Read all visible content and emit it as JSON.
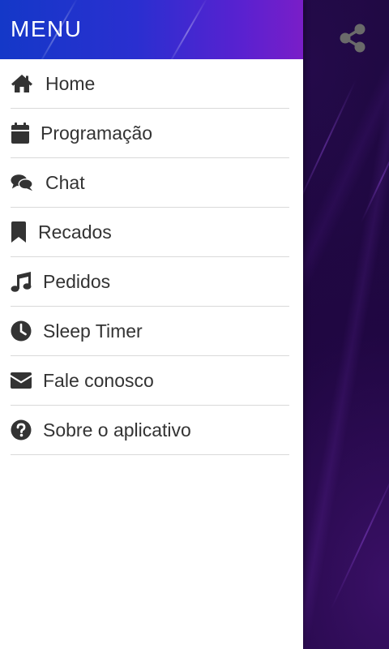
{
  "drawer": {
    "title": "MENU",
    "items": [
      {
        "label": "Home",
        "icon": "home-icon"
      },
      {
        "label": "Programação",
        "icon": "calendar-icon"
      },
      {
        "label": "Chat",
        "icon": "chat-icon"
      },
      {
        "label": "Recados",
        "icon": "bookmark-icon"
      },
      {
        "label": "Pedidos",
        "icon": "music-note-icon"
      },
      {
        "label": "Sleep Timer",
        "icon": "clock-icon"
      },
      {
        "label": "Fale conosco",
        "icon": "envelope-icon"
      },
      {
        "label": "Sobre o aplicativo",
        "icon": "question-circle-icon"
      }
    ]
  },
  "toolbar": {
    "share_icon": "share-icon"
  },
  "colors": {
    "header_start": "#1438c8",
    "header_end": "#7a1ec8",
    "text": "#333333",
    "divider": "#d9d9d9",
    "background": "#14052a"
  }
}
